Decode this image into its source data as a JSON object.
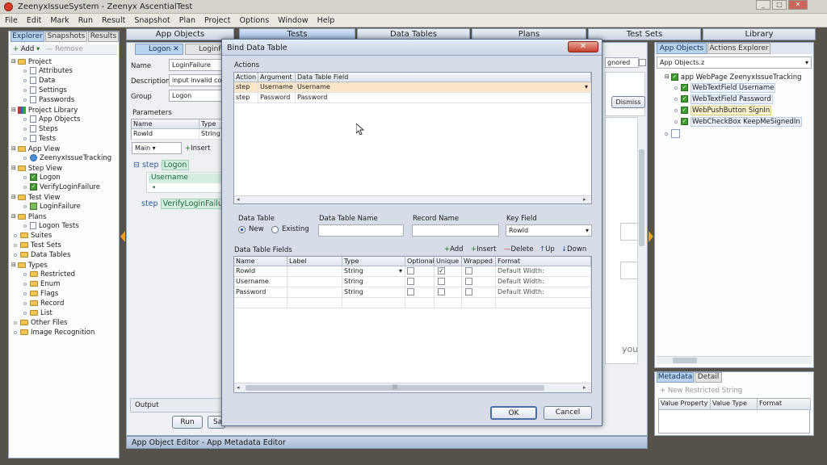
{
  "window": {
    "title": "ZeenyxIssueSystem - Zeenyx AscentialTest"
  },
  "menu": [
    "File",
    "Edit",
    "Mark",
    "Run",
    "Result",
    "Snapshot",
    "Plan",
    "Project",
    "Options",
    "Window",
    "Help"
  ],
  "top_tabs": [
    "App Objects",
    "Tests",
    "Data Tables",
    "Plans",
    "Test Sets",
    "Library"
  ],
  "explorer": {
    "tabs": [
      "Explorer",
      "Snapshots",
      "Results"
    ],
    "add_label": "Add",
    "remove_label": "Remove",
    "items": [
      "Project",
      "Attributes",
      "Data",
      "Settings",
      "Passwords",
      "Project Library",
      "App Objects",
      "Steps",
      "Tests",
      "App View",
      "ZeenyxIssueTracking",
      "Step View",
      "Logon",
      "VerifyLoginFailure",
      "Test View",
      "LoginFailure",
      "Plans",
      "Logon Tests",
      "Suites",
      "Test Sets",
      "Data Tables",
      "Types",
      "Restricted",
      "Enum",
      "Flags",
      "Record",
      "List",
      "Other Files",
      "Image Recognition"
    ]
  },
  "editor": {
    "tabs": [
      "Logon",
      "LoginF"
    ],
    "name_label": "Name",
    "name_value": "LoginFailure",
    "desc_label": "Description",
    "desc_value": "input invalid cor",
    "group_label": "Group",
    "group_value": "Logon",
    "params_label": "Parameters",
    "params_headers": [
      "Name",
      "Type"
    ],
    "params_row": [
      "RowId",
      "String"
    ],
    "main_value": "Main",
    "insert_label": "Insert",
    "steps": [
      {
        "kw": "step",
        "name": "Logon",
        "arg": "Username"
      },
      {
        "kw": "step",
        "name": "VerifyLoginFailu"
      }
    ],
    "output_label": "Output",
    "run_label": "Run",
    "save_label": "Sa"
  },
  "right_panel": {
    "ignored_label": "gnored",
    "dismiss_label": "Dismiss",
    "your_text": "your",
    "tabs": [
      "App Objects",
      "Actions Explorer"
    ],
    "dropdown": "App Objects.z",
    "tree": [
      "app WebPage ZeenyxIssueTracking",
      "WebTextField Username",
      "WebTextField Password",
      "WebPushButton SignIn",
      "WebCheckBox KeepMeSignedIn"
    ],
    "meta_tabs": [
      "Metadata",
      "Detail"
    ],
    "new_restricted": "New Restricted String",
    "meta_headers": [
      "Value Property",
      "Value Type",
      "Format"
    ]
  },
  "status_bar": "App Object Editor - App Metadata Editor",
  "dialog": {
    "title": "Bind Data Table",
    "actions_label": "Actions",
    "actions_headers": [
      "Action",
      "Argument",
      "Data Table Field"
    ],
    "actions_rows": [
      [
        "step",
        "Username",
        "Username"
      ],
      [
        "step",
        "Password",
        "Password"
      ]
    ],
    "data_table_label": "Data Table",
    "radio_new": "New",
    "radio_existing": "Existing",
    "table_name_label": "Data Table Name",
    "record_name_label": "Record Name",
    "key_field_label": "Key Field",
    "key_field_value": "RowId",
    "fields_label": "Data Table Fields",
    "tool_add": "Add",
    "tool_insert": "Insert",
    "tool_delete": "Delete",
    "tool_up": "Up",
    "tool_down": "Down",
    "fields_headers": [
      "Name",
      "Label",
      "Type",
      "Optional",
      "Unique",
      "Wrapped",
      "Format"
    ],
    "fields_rows": [
      {
        "name": "RowId",
        "type": "String",
        "unique": true,
        "format": "Default Width:"
      },
      {
        "name": "Username",
        "type": "String",
        "unique": false,
        "format": "Default Width:"
      },
      {
        "name": "Password",
        "type": "String",
        "unique": false,
        "format": "Default Width:"
      }
    ],
    "ok_label": "OK",
    "cancel_label": "Cancel"
  }
}
